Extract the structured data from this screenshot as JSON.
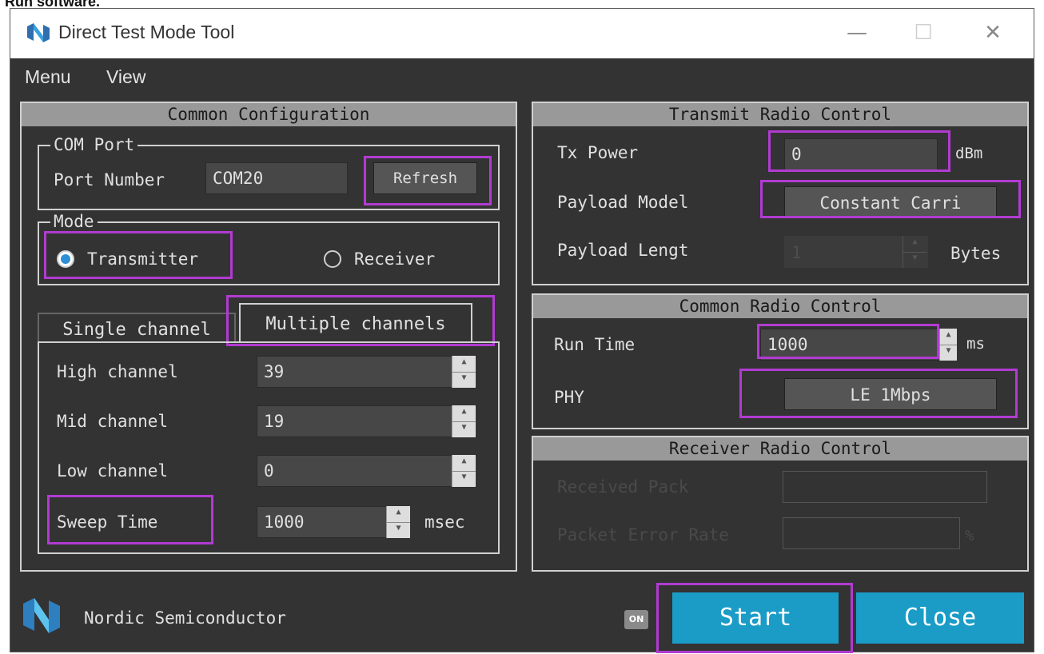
{
  "page_heading": "Run software.",
  "window": {
    "title": "Direct Test Mode Tool",
    "controls": {
      "minimize": "—",
      "maximize": "☐",
      "close": "✕"
    }
  },
  "menubar": [
    "Menu",
    "View"
  ],
  "common_config": {
    "header": "Common Configuration",
    "com_port": {
      "title": "COM Port",
      "label": "Port Number",
      "value": "COM20",
      "refresh_label": "Refresh"
    },
    "mode": {
      "title": "Mode",
      "transmitter": "Transmitter",
      "receiver": "Receiver",
      "selected": "Transmitter"
    },
    "tabs": [
      "Single channel",
      "Multiple channels"
    ],
    "active_tab": "Multiple channels",
    "channels": [
      {
        "label": "High channel",
        "value": "39"
      },
      {
        "label": "Mid channel",
        "value": "19"
      },
      {
        "label": "Low channel",
        "value": "0"
      }
    ],
    "sweep": {
      "label": "Sweep Time",
      "value": "1000",
      "unit": "msec"
    }
  },
  "transmit_radio": {
    "header": "Transmit Radio Control",
    "tx_power": {
      "label": "Tx Power",
      "value": "0",
      "unit": "dBm"
    },
    "payload_model": {
      "label": "Payload Model",
      "value": "Constant Carri"
    },
    "payload_length": {
      "label": "Payload Lengt",
      "value": "1",
      "unit": "Bytes"
    }
  },
  "common_radio": {
    "header": "Common Radio Control",
    "run_time": {
      "label": "Run Time",
      "value": "1000",
      "unit": "ms"
    },
    "phy": {
      "label": "PHY",
      "value": "LE 1Mbps"
    }
  },
  "receiver_radio": {
    "header": "Receiver Radio Control",
    "received_pack": {
      "label": "Received Pack"
    },
    "packet_error_rate": {
      "label": "Packet Error Rate",
      "unit": "%"
    }
  },
  "footer": {
    "brand": "Nordic Semiconductor",
    "on_indicator": "ON",
    "start_label": "Start",
    "close_label": "Close"
  },
  "colors": {
    "window_bg": "#333333",
    "panel_header": "#999999",
    "button_accent": "#1a9cc7",
    "highlight": "#b13bd1",
    "radio_selected": "#2d8fd6"
  }
}
